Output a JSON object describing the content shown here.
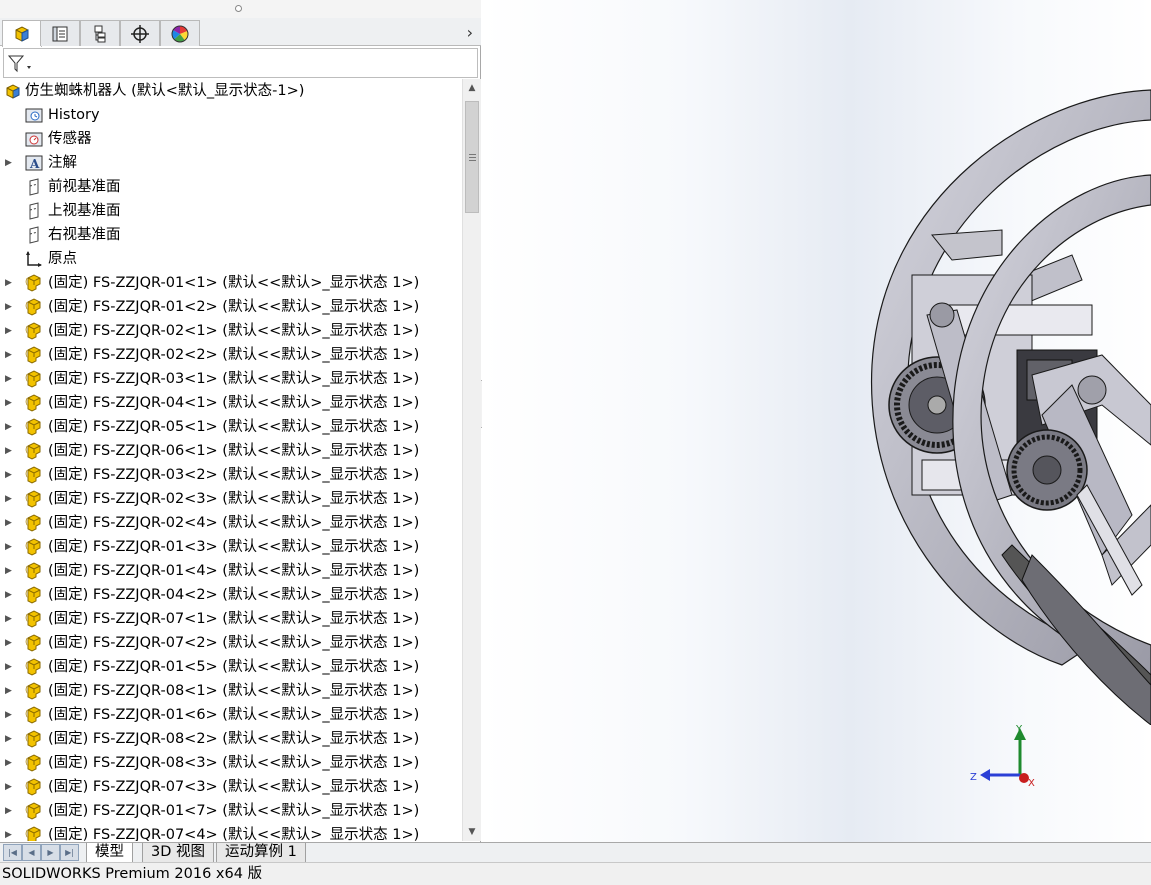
{
  "feature_manager": {
    "tabs": [
      {
        "name": "featuremanager-tab",
        "icon": "feature-tree-icon"
      },
      {
        "name": "propertymanager-tab",
        "icon": "property-list-icon"
      },
      {
        "name": "configurationmanager-tab",
        "icon": "configuration-icon"
      },
      {
        "name": "dimxpert-tab",
        "icon": "crosshair-icon"
      },
      {
        "name": "display-manager-tab",
        "icon": "color-wheel-icon"
      }
    ],
    "expand_glyph": "›",
    "tree": {
      "root": "仿生蜘蛛机器人  (默认<默认_显示状态-1>)",
      "items": [
        {
          "label": "History",
          "icon": "history-folder-icon",
          "expandable": false
        },
        {
          "label": "传感器",
          "icon": "sensor-icon",
          "expandable": false
        },
        {
          "label": "注解",
          "icon": "annotation-icon",
          "expandable": true
        },
        {
          "label": "前视基准面",
          "icon": "plane-icon",
          "expandable": false
        },
        {
          "label": "上视基准面",
          "icon": "plane-icon",
          "expandable": false
        },
        {
          "label": "右视基准面",
          "icon": "plane-icon",
          "expandable": false
        },
        {
          "label": "原点",
          "icon": "origin-icon",
          "expandable": false
        },
        {
          "label": "(固定) FS-ZZJQR-01<1> (默认<<默认>_显示状态 1>)",
          "icon": "part-icon",
          "expandable": true
        },
        {
          "label": "(固定) FS-ZZJQR-01<2> (默认<<默认>_显示状态 1>)",
          "icon": "part-icon",
          "expandable": true
        },
        {
          "label": "(固定) FS-ZZJQR-02<1> (默认<<默认>_显示状态 1>)",
          "icon": "part-icon",
          "expandable": true
        },
        {
          "label": "(固定) FS-ZZJQR-02<2> (默认<<默认>_显示状态 1>)",
          "icon": "part-icon",
          "expandable": true
        },
        {
          "label": "(固定) FS-ZZJQR-03<1> (默认<<默认>_显示状态 1>)",
          "icon": "part-icon",
          "expandable": true
        },
        {
          "label": "(固定) FS-ZZJQR-04<1> (默认<<默认>_显示状态 1>)",
          "icon": "part-icon",
          "expandable": true
        },
        {
          "label": "(固定) FS-ZZJQR-05<1> (默认<<默认>_显示状态 1>)",
          "icon": "part-icon",
          "expandable": true
        },
        {
          "label": "(固定) FS-ZZJQR-06<1> (默认<<默认>_显示状态 1>)",
          "icon": "part-icon",
          "expandable": true
        },
        {
          "label": "(固定) FS-ZZJQR-03<2> (默认<<默认>_显示状态 1>)",
          "icon": "part-icon",
          "expandable": true
        },
        {
          "label": "(固定) FS-ZZJQR-02<3> (默认<<默认>_显示状态 1>)",
          "icon": "part-icon",
          "expandable": true
        },
        {
          "label": "(固定) FS-ZZJQR-02<4> (默认<<默认>_显示状态 1>)",
          "icon": "part-icon",
          "expandable": true
        },
        {
          "label": "(固定) FS-ZZJQR-01<3> (默认<<默认>_显示状态 1>)",
          "icon": "part-icon",
          "expandable": true
        },
        {
          "label": "(固定) FS-ZZJQR-01<4> (默认<<默认>_显示状态 1>)",
          "icon": "part-icon",
          "expandable": true
        },
        {
          "label": "(固定) FS-ZZJQR-04<2> (默认<<默认>_显示状态 1>)",
          "icon": "part-icon",
          "expandable": true
        },
        {
          "label": "(固定) FS-ZZJQR-07<1> (默认<<默认>_显示状态 1>)",
          "icon": "part-icon",
          "expandable": true
        },
        {
          "label": "(固定) FS-ZZJQR-07<2> (默认<<默认>_显示状态 1>)",
          "icon": "part-icon",
          "expandable": true
        },
        {
          "label": "(固定) FS-ZZJQR-01<5> (默认<<默认>_显示状态 1>)",
          "icon": "part-icon",
          "expandable": true
        },
        {
          "label": "(固定) FS-ZZJQR-08<1> (默认<<默认>_显示状态 1>)",
          "icon": "part-icon",
          "expandable": true
        },
        {
          "label": "(固定) FS-ZZJQR-01<6> (默认<<默认>_显示状态 1>)",
          "icon": "part-icon",
          "expandable": true
        },
        {
          "label": "(固定) FS-ZZJQR-08<2> (默认<<默认>_显示状态 1>)",
          "icon": "part-icon",
          "expandable": true
        },
        {
          "label": "(固定) FS-ZZJQR-08<3> (默认<<默认>_显示状态 1>)",
          "icon": "part-icon",
          "expandable": true
        },
        {
          "label": "(固定) FS-ZZJQR-07<3> (默认<<默认>_显示状态 1>)",
          "icon": "part-icon",
          "expandable": true
        },
        {
          "label": "(固定) FS-ZZJQR-01<7> (默认<<默认>_显示状态 1>)",
          "icon": "part-icon",
          "expandable": true
        },
        {
          "label": "(固定) FS-ZZJQR-07<4> (默认<<默认>_显示状态 1>)",
          "icon": "part-icon",
          "expandable": true
        }
      ]
    }
  },
  "viewport": {
    "triad": {
      "y": "Y",
      "z": "Z",
      "x": "X"
    },
    "colors": {
      "y_axis": "#1f8a2e",
      "z_axis": "#2b3fd6",
      "x_axis": "#c81e1e",
      "part": "#b9b9c3",
      "part_edge": "#1a1a1a"
    }
  },
  "bottom_tabs": {
    "nav_glyphs": [
      "|◀",
      "◀",
      "▶",
      "▶|"
    ],
    "tabs": [
      "模型",
      "3D 视图",
      "运动算例 1"
    ]
  },
  "status_bar": {
    "text": "SOLIDWORKS Premium 2016 x64 版"
  },
  "colors": {
    "part_icon": "#f2c200",
    "part_icon_edge": "#8a6a00"
  }
}
